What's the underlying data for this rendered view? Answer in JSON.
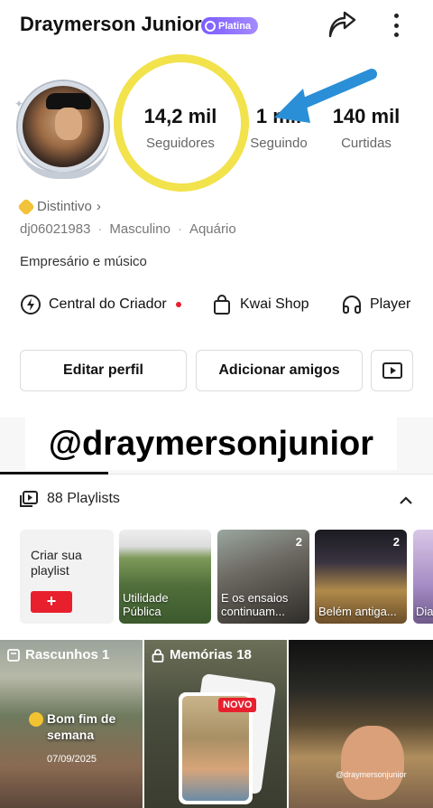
{
  "header": {
    "name": "Draymerson Junior",
    "badge": "Platina"
  },
  "stats": [
    {
      "value": "14,2 mil",
      "label": "Seguidores"
    },
    {
      "value": "1 mil",
      "label": "Seguindo"
    },
    {
      "value": "140 mil",
      "label": "Curtidas"
    }
  ],
  "profile": {
    "distintivo": "Distintivo",
    "user_id": "dj06021983",
    "gender": "Masculino",
    "sign": "Aquário",
    "bio": "Empresário e músico"
  },
  "quick_links": [
    {
      "label": "Central do Criador",
      "icon": "lightning-icon"
    },
    {
      "label": "Kwai Shop",
      "icon": "shopping-bag-icon"
    },
    {
      "label": "Player",
      "icon": "headphones-icon"
    }
  ],
  "buttons": {
    "edit": "Editar perfil",
    "add_friends": "Adicionar amigos"
  },
  "banner": {
    "username": "@draymersonjunior"
  },
  "playlists": {
    "heading": "88 Playlists",
    "create_label": "Criar sua playlist",
    "create_button": "+",
    "items": [
      {
        "title": "Utilidade Pública",
        "count": ""
      },
      {
        "title": "E os ensaios continuam...",
        "count": "2"
      },
      {
        "title": "Belém antiga...",
        "count": "2"
      },
      {
        "title": "Dia",
        "count": ""
      }
    ]
  },
  "grid": {
    "drafts": {
      "label": "Rascunhos 1",
      "caption": "Bom fim de semana",
      "date": "07/09/2025"
    },
    "memories": {
      "label": "Memórias 18",
      "badge": "NOVO"
    },
    "watermark": "@draymersonjunior"
  },
  "colors": {
    "accent_red": "#e8202e",
    "badge_purple": "#7b5cff",
    "highlight_yellow": "#f2e24c",
    "arrow_blue": "#2a8fd6"
  }
}
